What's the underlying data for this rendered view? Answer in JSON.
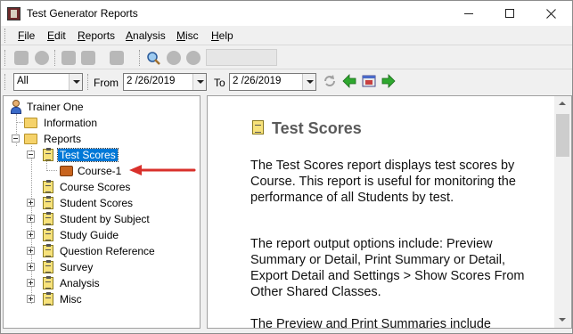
{
  "window": {
    "title": "Test Generator Reports"
  },
  "menu": {
    "items": [
      "File",
      "Edit",
      "Reports",
      "Analysis",
      "Misc",
      "Help"
    ],
    "mnemonics": [
      "F",
      "E",
      "R",
      "A",
      "M",
      "H"
    ]
  },
  "filter": {
    "scope_value": "All",
    "from_label": "From",
    "from_value": "2 /26/2019",
    "to_label": "To",
    "to_value": "2 /26/2019"
  },
  "tree": {
    "root": "Trainer One",
    "information": "Information",
    "reports": "Reports",
    "test_scores": "Test Scores",
    "course_1": "Course-1",
    "items": [
      "Course Scores",
      "Student Scores",
      "Student by Subject",
      "Study Guide",
      "Question Reference",
      "Survey",
      "Analysis",
      "Misc"
    ]
  },
  "content": {
    "title": "Test Scores",
    "p1": "The Test Scores report displays test scores by Course.  This report is useful for monitoring the performance of all Students by test.",
    "p2": "The report output options include: Preview Summary or Detail, Print Summary or Detail, Export Detail and Settings > Show Scores From Other Shared Classes.",
    "p3": "The Preview and Print Summaries include"
  },
  "colors": {
    "selection": "#0078d7",
    "annotation_arrow": "#d9302b",
    "nav_arrow_green": "#2fa82f",
    "title_gray": "#5a5a5a"
  },
  "icons": [
    "app-icon",
    "minimize-icon",
    "maximize-icon",
    "close-icon",
    "refresh-icon",
    "back-icon",
    "calendar-icon",
    "forward-icon",
    "report-icon",
    "folder-icon",
    "user-icon",
    "briefcase-icon"
  ]
}
